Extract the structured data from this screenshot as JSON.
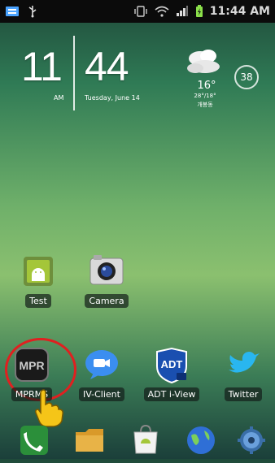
{
  "status_bar": {
    "time": "11:44 AM",
    "icons": [
      "notification-icon",
      "usb-icon",
      "vibrate-icon",
      "wifi-icon",
      "signal-icon",
      "battery-icon"
    ]
  },
  "clock_widget": {
    "hour": "11",
    "minute": "44",
    "ampm": "AM",
    "date": "Tuesday, June 14"
  },
  "weather_widget": {
    "icon": "cloudy-icon",
    "temperature": "16°",
    "range": "28°/18°",
    "location": "개봉동"
  },
  "battery_widget": {
    "level": "38"
  },
  "home_apps": [
    {
      "label": "Test",
      "icon": "android-test-icon"
    },
    {
      "label": "Camera",
      "icon": "camera-icon"
    }
  ],
  "shortcut_row": [
    {
      "label": "MPRMS",
      "icon": "mprms-icon",
      "logo_text": "MPR"
    },
    {
      "label": "IV-Client",
      "icon": "iv-client-icon"
    },
    {
      "label": "ADT i-View",
      "icon": "adt-iview-icon",
      "logo_text": "ADT"
    },
    {
      "label": "Twitter",
      "icon": "twitter-icon"
    }
  ],
  "dock": [
    {
      "icon": "phone-icon"
    },
    {
      "icon": "folder-icon"
    },
    {
      "icon": "market-icon"
    },
    {
      "icon": "browser-icon"
    },
    {
      "icon": "settings-icon"
    }
  ],
  "colors": {
    "highlight_ring": "#e02020",
    "status_bar_bg": "#0b0b0b"
  }
}
